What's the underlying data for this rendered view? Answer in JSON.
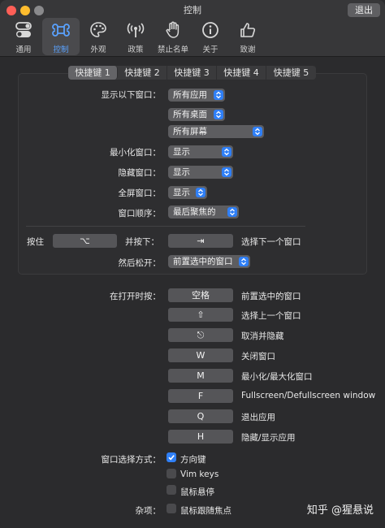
{
  "window": {
    "title": "控制",
    "quit_label": "退出"
  },
  "toolbar": [
    {
      "label": "通用",
      "icon": "toggle-switch-icon"
    },
    {
      "label": "控制",
      "icon": "command-key-icon",
      "active": true
    },
    {
      "label": "外观",
      "icon": "palette-icon"
    },
    {
      "label": "政策",
      "icon": "broadcast-icon"
    },
    {
      "label": "禁止名单",
      "icon": "raised-hand-icon"
    },
    {
      "label": "关于",
      "icon": "info-icon"
    },
    {
      "label": "致谢",
      "icon": "thumbs-up-icon"
    }
  ],
  "tabs": [
    "快捷键 1",
    "快捷键 2",
    "快捷键 3",
    "快捷键 4",
    "快捷键 5"
  ],
  "shortcut": {
    "show_windows_label": "显示以下窗口：",
    "app_scope": "所有应用",
    "desktop_scope": "所有桌面",
    "screen_scope": "所有屏幕",
    "minimized_label": "最小化窗口：",
    "minimized_value": "显示",
    "hidden_label": "隐藏窗口：",
    "hidden_value": "显示",
    "fullscreen_label": "全屏窗口：",
    "fullscreen_value": "显示",
    "order_label": "窗口顺序：",
    "order_value": "最后聚焦的",
    "hold_label": "按住",
    "hold_key": "⌥",
    "press_label": "并按下：",
    "press_key": "⇥",
    "press_action": "选择下一个窗口",
    "release_label": "然后松开：",
    "release_value": "前置选中的窗口"
  },
  "while_open": {
    "label": "在打开时按：",
    "rows": [
      {
        "key": "空格",
        "action": "前置选中的窗口"
      },
      {
        "key": "⇧",
        "action": "选择上一个窗口"
      },
      {
        "key": "⎋",
        "action": "取消并隐藏"
      },
      {
        "key": "W",
        "action": "关闭窗口"
      },
      {
        "key": "M",
        "action": "最小化/最大化窗口"
      },
      {
        "key": "F",
        "action": "Fullscreen/Defullscreen window"
      },
      {
        "key": "Q",
        "action": "退出应用"
      },
      {
        "key": "H",
        "action": "隐藏/显示应用"
      }
    ]
  },
  "selection": {
    "label": "窗口选择方式：",
    "options": [
      {
        "label": "方向键",
        "checked": true
      },
      {
        "label": "Vim keys",
        "checked": false
      },
      {
        "label": "鼠标悬停",
        "checked": false
      }
    ]
  },
  "misc": {
    "label": "杂项：",
    "option": {
      "label": "鼠标跟随焦点",
      "checked": false
    }
  },
  "watermark": "知乎 @猩悬说",
  "colors": {
    "accent": "#2f7ff6",
    "active_tool": "#5aa2ff"
  }
}
